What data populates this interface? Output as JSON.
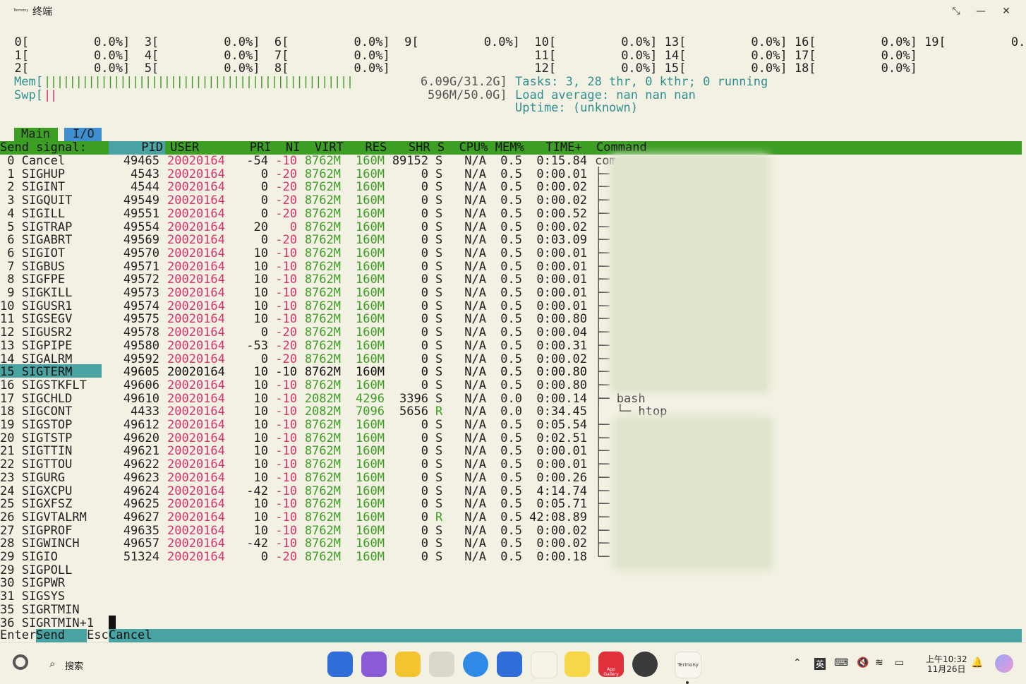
{
  "window": {
    "app_icon_text": "Termony",
    "title": "终端",
    "btn_restore": "⤡",
    "btn_min": "—",
    "btn_close": "✕"
  },
  "cpu_rows": [
    "  0[         0.0%]  3[         0.0%]  6[         0.0%]  9[         0.0%]  10[         0.0%] 13[         0.0%] 16[         0.0%] 19[         0.0%]",
    "  1[         0.0%]  4[         0.0%]  7[         0.0%]                    11[         0.0%] 14[         0.0%] 17[         0.0%]",
    "  2[         0.0%]  5[         0.0%]  8[         0.0%]                    12[         0.0%] 15[         0.0%] 18[         0.0%]"
  ],
  "mem": {
    "label": "Mem[",
    "bar": "|||||||||||||||||||||||||||||||||||||||||||||||||",
    "value": "6.09G/31.2G]"
  },
  "swp": {
    "label": "Swp[",
    "bar": "||",
    "value": "596M/50.0G]"
  },
  "tasks": {
    "text": "Tasks: 3, 28 thr, 0 kthr; 0 running"
  },
  "load": {
    "text": "Load average: nan nan nan"
  },
  "uptime": {
    "text": "Uptime: (unknown)"
  },
  "tabs": {
    "main": "Main",
    "io": "I/O"
  },
  "send_signal_label": "Send signal:",
  "columns": " PID USER       PRI  NI  VIRT   RES   SHR S  CPU% MEM%   TIME+  Command",
  "signals": [
    " 0 Cancel",
    " 1 SIGHUP",
    " 2 SIGINT",
    " 3 SIGQUIT",
    " 4 SIGILL",
    " 5 SIGTRAP",
    " 6 SIGABRT",
    " 6 SIGIOT",
    " 7 SIGBUS",
    " 8 SIGFPE",
    " 9 SIGKILL",
    "10 SIGUSR1",
    "11 SIGSEGV",
    "12 SIGUSR2",
    "13 SIGPIPE",
    "14 SIGALRM",
    "15 SIGTERM",
    "16 SIGSTKFLT",
    "17 SIGCHLD",
    "18 SIGCONT",
    "19 SIGSTOP",
    "20 SIGTSTP",
    "21 SIGTTIN",
    "22 SIGTTOU",
    "23 SIGURG",
    "24 SIGXCPU",
    "25 SIGXFSZ",
    "26 SIGVTALRM",
    "27 SIGPROF",
    "28 SIGWINCH",
    "29 SIGIO",
    "29 SIGPOLL",
    "30 SIGPWR",
    "31 SIGSYS",
    "35 SIGRTMIN",
    "36 SIGRTMIN+1"
  ],
  "processes": [
    {
      "pid": "49465",
      "user": "20020164",
      "pri": "-54",
      "ni": "-10",
      "virt": "8762M",
      "res": "160M",
      "shr": "89152",
      "s": "S",
      "cpu": "N/A",
      "mem": "0.5",
      "time": "0:15.84",
      "cmd": "com"
    },
    {
      "pid": "4543",
      "user": "20020164",
      "pri": "0",
      "ni": "-20",
      "virt": "8762M",
      "res": "160M",
      "shr": "0",
      "s": "S",
      "cpu": "N/A",
      "mem": "0.5",
      "time": "0:00.01",
      "cmd": "├─"
    },
    {
      "pid": "4544",
      "user": "20020164",
      "pri": "0",
      "ni": "-20",
      "virt": "8762M",
      "res": "160M",
      "shr": "0",
      "s": "S",
      "cpu": "N/A",
      "mem": "0.5",
      "time": "0:00.02",
      "cmd": "├─"
    },
    {
      "pid": "49549",
      "user": "20020164",
      "pri": "0",
      "ni": "-20",
      "virt": "8762M",
      "res": "160M",
      "shr": "0",
      "s": "S",
      "cpu": "N/A",
      "mem": "0.5",
      "time": "0:00.02",
      "cmd": "├─"
    },
    {
      "pid": "49551",
      "user": "20020164",
      "pri": "0",
      "ni": "-20",
      "virt": "8762M",
      "res": "160M",
      "shr": "0",
      "s": "S",
      "cpu": "N/A",
      "mem": "0.5",
      "time": "0:00.52",
      "cmd": "├─"
    },
    {
      "pid": "49554",
      "user": "20020164",
      "pri": "20",
      "ni": "0",
      "virt": "8762M",
      "res": "160M",
      "shr": "0",
      "s": "S",
      "cpu": "N/A",
      "mem": "0.5",
      "time": "0:00.02",
      "cmd": "├─"
    },
    {
      "pid": "49569",
      "user": "20020164",
      "pri": "0",
      "ni": "-20",
      "virt": "8762M",
      "res": "160M",
      "shr": "0",
      "s": "S",
      "cpu": "N/A",
      "mem": "0.5",
      "time": "0:03.09",
      "cmd": "├─"
    },
    {
      "pid": "49570",
      "user": "20020164",
      "pri": "10",
      "ni": "-10",
      "virt": "8762M",
      "res": "160M",
      "shr": "0",
      "s": "S",
      "cpu": "N/A",
      "mem": "0.5",
      "time": "0:00.01",
      "cmd": "├─"
    },
    {
      "pid": "49571",
      "user": "20020164",
      "pri": "10",
      "ni": "-10",
      "virt": "8762M",
      "res": "160M",
      "shr": "0",
      "s": "S",
      "cpu": "N/A",
      "mem": "0.5",
      "time": "0:00.01",
      "cmd": "├─"
    },
    {
      "pid": "49572",
      "user": "20020164",
      "pri": "10",
      "ni": "-10",
      "virt": "8762M",
      "res": "160M",
      "shr": "0",
      "s": "S",
      "cpu": "N/A",
      "mem": "0.5",
      "time": "0:00.01",
      "cmd": "├─"
    },
    {
      "pid": "49573",
      "user": "20020164",
      "pri": "10",
      "ni": "-10",
      "virt": "8762M",
      "res": "160M",
      "shr": "0",
      "s": "S",
      "cpu": "N/A",
      "mem": "0.5",
      "time": "0:00.01",
      "cmd": "├─"
    },
    {
      "pid": "49574",
      "user": "20020164",
      "pri": "10",
      "ni": "-10",
      "virt": "8762M",
      "res": "160M",
      "shr": "0",
      "s": "S",
      "cpu": "N/A",
      "mem": "0.5",
      "time": "0:00.01",
      "cmd": "├─"
    },
    {
      "pid": "49575",
      "user": "20020164",
      "pri": "10",
      "ni": "-10",
      "virt": "8762M",
      "res": "160M",
      "shr": "0",
      "s": "S",
      "cpu": "N/A",
      "mem": "0.5",
      "time": "0:00.80",
      "cmd": "├─"
    },
    {
      "pid": "49578",
      "user": "20020164",
      "pri": "0",
      "ni": "-20",
      "virt": "8762M",
      "res": "160M",
      "shr": "0",
      "s": "S",
      "cpu": "N/A",
      "mem": "0.5",
      "time": "0:00.04",
      "cmd": "├─"
    },
    {
      "pid": "49580",
      "user": "20020164",
      "pri": "-53",
      "ni": "-20",
      "virt": "8762M",
      "res": "160M",
      "shr": "0",
      "s": "S",
      "cpu": "N/A",
      "mem": "0.5",
      "time": "0:00.31",
      "cmd": "├─"
    },
    {
      "pid": "49592",
      "user": "20020164",
      "pri": "0",
      "ni": "-20",
      "virt": "8762M",
      "res": "160M",
      "shr": "0",
      "s": "S",
      "cpu": "N/A",
      "mem": "0.5",
      "time": "0:00.02",
      "cmd": "├─"
    },
    {
      "pid": "49605",
      "user": "20020164",
      "pri": "10",
      "ni": "-10",
      "virt": "8762M",
      "res": "160M",
      "shr": "0",
      "s": "S",
      "cpu": "N/A",
      "mem": "0.5",
      "time": "0:00.80",
      "cmd": "├─"
    },
    {
      "pid": "49606",
      "user": "20020164",
      "pri": "10",
      "ni": "-10",
      "virt": "8762M",
      "res": "160M",
      "shr": "0",
      "s": "S",
      "cpu": "N/A",
      "mem": "0.5",
      "time": "0:00.80",
      "cmd": "├─"
    },
    {
      "pid": "49610",
      "user": "20020164",
      "pri": "10",
      "ni": "-10",
      "virt": "2082M",
      "res": "4296",
      "shr": "3396",
      "s": "S",
      "cpu": "N/A",
      "mem": "0.0",
      "time": "0:00.14",
      "cmd": "├─ bash"
    },
    {
      "pid": "4433",
      "user": "20020164",
      "pri": "10",
      "ni": "-10",
      "virt": "2082M",
      "res": "7096",
      "shr": "5656",
      "s": "R",
      "cpu": "N/A",
      "mem": "0.0",
      "time": "0:34.45",
      "cmd": "│  └─ htop"
    },
    {
      "pid": "49612",
      "user": "20020164",
      "pri": "10",
      "ni": "-10",
      "virt": "8762M",
      "res": "160M",
      "shr": "0",
      "s": "S",
      "cpu": "N/A",
      "mem": "0.5",
      "time": "0:05.54",
      "cmd": "├─"
    },
    {
      "pid": "49620",
      "user": "20020164",
      "pri": "10",
      "ni": "-10",
      "virt": "8762M",
      "res": "160M",
      "shr": "0",
      "s": "S",
      "cpu": "N/A",
      "mem": "0.5",
      "time": "0:02.51",
      "cmd": "├─"
    },
    {
      "pid": "49621",
      "user": "20020164",
      "pri": "10",
      "ni": "-10",
      "virt": "8762M",
      "res": "160M",
      "shr": "0",
      "s": "S",
      "cpu": "N/A",
      "mem": "0.5",
      "time": "0:00.01",
      "cmd": "├─"
    },
    {
      "pid": "49622",
      "user": "20020164",
      "pri": "10",
      "ni": "-10",
      "virt": "8762M",
      "res": "160M",
      "shr": "0",
      "s": "S",
      "cpu": "N/A",
      "mem": "0.5",
      "time": "0:00.01",
      "cmd": "├─"
    },
    {
      "pid": "49623",
      "user": "20020164",
      "pri": "10",
      "ni": "-10",
      "virt": "8762M",
      "res": "160M",
      "shr": "0",
      "s": "S",
      "cpu": "N/A",
      "mem": "0.5",
      "time": "0:00.26",
      "cmd": "├─"
    },
    {
      "pid": "49624",
      "user": "20020164",
      "pri": "-42",
      "ni": "-10",
      "virt": "8762M",
      "res": "160M",
      "shr": "0",
      "s": "S",
      "cpu": "N/A",
      "mem": "0.5",
      "time": "4:14.74",
      "cmd": "├─"
    },
    {
      "pid": "49625",
      "user": "20020164",
      "pri": "10",
      "ni": "-10",
      "virt": "8762M",
      "res": "160M",
      "shr": "0",
      "s": "S",
      "cpu": "N/A",
      "mem": "0.5",
      "time": "0:05.71",
      "cmd": "├─"
    },
    {
      "pid": "49627",
      "user": "20020164",
      "pri": "10",
      "ni": "-10",
      "virt": "8762M",
      "res": "160M",
      "shr": "0",
      "s": "R",
      "cpu": "N/A",
      "mem": "0.5",
      "time": "42:08.89",
      "cmd": "├─"
    },
    {
      "pid": "49635",
      "user": "20020164",
      "pri": "10",
      "ni": "-10",
      "virt": "8762M",
      "res": "160M",
      "shr": "0",
      "s": "S",
      "cpu": "N/A",
      "mem": "0.5",
      "time": "0:00.02",
      "cmd": "├─"
    },
    {
      "pid": "49657",
      "user": "20020164",
      "pri": "-42",
      "ni": "-10",
      "virt": "8762M",
      "res": "160M",
      "shr": "0",
      "s": "S",
      "cpu": "N/A",
      "mem": "0.5",
      "time": "0:00.02",
      "cmd": "├─"
    },
    {
      "pid": "51324",
      "user": "20020164",
      "pri": "0",
      "ni": "-20",
      "virt": "8762M",
      "res": "160M",
      "shr": "0",
      "s": "S",
      "cpu": "N/A",
      "mem": "0.5",
      "time": "0:00.18",
      "cmd": "└─"
    }
  ],
  "footer": {
    "enter_key": "Enter",
    "enter_label": "Send",
    "esc_key": "Esc",
    "esc_label": "Cancel"
  },
  "taskbar": {
    "search_label": "搜索",
    "apps": [
      "launcher-icon",
      "multitask-icon",
      "files-icon",
      "trash-icon",
      "browser-icon",
      "mail-icon",
      "photos-icon",
      "notes-icon",
      "appgallery-icon",
      "settings-icon",
      "termony-icon"
    ],
    "appgallery_label": "App Gallery",
    "termony_label": "Termony",
    "ime": "英",
    "time": "上午10:32",
    "date": "11月26日"
  },
  "colors": {
    "green": "#3d9e24",
    "teal": "#4aa3a3",
    "blue": "#3f8fd0",
    "red": "#d6336c",
    "cyan": "#2f8f8f",
    "bg": "#f3f1e4"
  }
}
